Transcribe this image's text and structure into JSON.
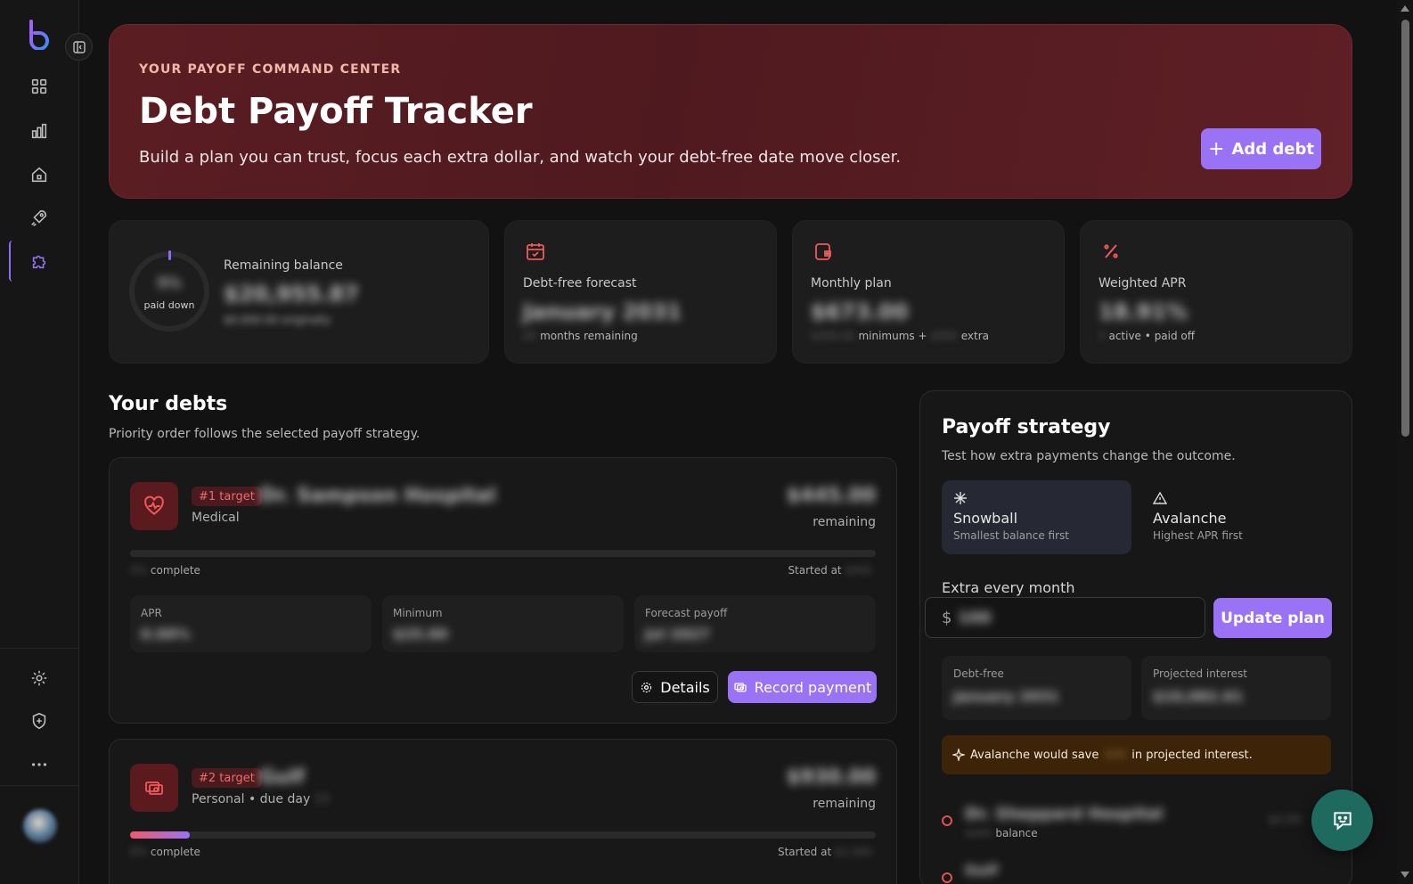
{
  "sidebar": {
    "nav": [
      {
        "name": "dashboard",
        "icon": "grid-icon"
      },
      {
        "name": "reports",
        "icon": "bar-chart-icon"
      },
      {
        "name": "home",
        "icon": "home-icon"
      },
      {
        "name": "goals",
        "icon": "rocket-icon"
      },
      {
        "name": "debts",
        "icon": "puzzle-icon",
        "active": true
      }
    ],
    "bottom": [
      {
        "name": "settings",
        "icon": "gear-icon"
      },
      {
        "name": "security",
        "icon": "shield-plus-icon"
      },
      {
        "name": "more",
        "icon": "more-horizontal-icon"
      }
    ]
  },
  "hero": {
    "eyebrow": "YOUR PAYOFF COMMAND CENTER",
    "title": "Debt Payoff Tracker",
    "subtitle": "Build a plan you can trust, focus each extra dollar, and watch your debt-free date move closer.",
    "add_button": "Add debt"
  },
  "stats": {
    "balance": {
      "label": "Remaining balance",
      "value": "$20,955.87",
      "sub": "$0,000.00 originally",
      "ring_pct": "5%",
      "ring_label": "paid down"
    },
    "forecast": {
      "label": "Debt-free forecast",
      "value": "January 2031",
      "sub_count": "00",
      "sub_label": "months remaining"
    },
    "monthly": {
      "label": "Monthly plan",
      "value": "$673.00",
      "sub_min": "$000.00",
      "sub_mid": "minimums +",
      "sub_extra": "$000",
      "sub_end": "extra"
    },
    "apr": {
      "label": "Weighted APR",
      "value": "18.91%",
      "active_count": "3",
      "active_label": "active",
      "paid_label": "paid off"
    }
  },
  "debts_section": {
    "title": "Your debts",
    "subtitle": "Priority order follows the selected payoff strategy."
  },
  "debts": [
    {
      "badge": "#1 target",
      "name": "Dr. Sampson Hospital",
      "category": "Medical",
      "amount": "$445.00",
      "remaining_label": "remaining",
      "pct": "0%",
      "complete_label": "complete",
      "started_label": "Started at",
      "started_value": "$445",
      "apr_label": "APR",
      "apr_value": "0.00%",
      "min_label": "Minimum",
      "min_value": "$25.00",
      "forecast_label": "Forecast payoff",
      "forecast_value": "Jul 2027",
      "details_label": "Details",
      "record_label": "Record payment"
    },
    {
      "badge": "#2 target",
      "name": "Gulf",
      "category": "Personal • due day",
      "due_day": "15",
      "amount": "$930.00",
      "remaining_label": "remaining",
      "pct": "8%",
      "complete_label": "complete",
      "started_label": "Started at",
      "started_value": "$1,000",
      "progress": 0.08
    }
  ],
  "strategy": {
    "title": "Payoff strategy",
    "subtitle": "Test how extra payments change the outcome.",
    "options": [
      {
        "name": "Snowball",
        "desc": "Smallest balance first",
        "icon": "snowflake-icon",
        "selected": true
      },
      {
        "name": "Avalanche",
        "desc": "Highest APR first",
        "icon": "warning-triangle-icon",
        "selected": false
      }
    ],
    "extra_label": "Extra every month",
    "currency": "$",
    "extra_value": "100",
    "update_button": "Update plan",
    "debt_free_label": "Debt-free",
    "debt_free_value": "January 2031",
    "interest_label": "Projected interest",
    "interest_value": "$10,082.61",
    "savings_prefix": "Avalanche would save",
    "savings_amount": "$90",
    "savings_suffix": "in projected interest.",
    "order": [
      {
        "name": "Dr. Sheppard Hospital",
        "balance_value": "$445",
        "balance_label": "balance",
        "right": "$0.00"
      },
      {
        "name": "Gulf"
      }
    ]
  },
  "colors": {
    "accent": "#9a72f6",
    "hero_bg": "#5a1d22",
    "danger": "#f05a6a",
    "chat": "#1e6a5e"
  }
}
